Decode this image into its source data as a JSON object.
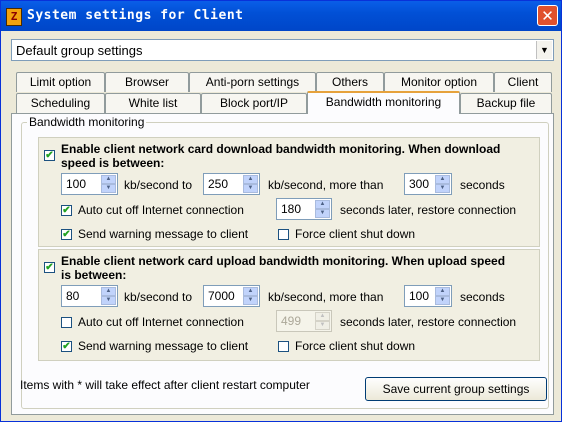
{
  "window": {
    "title": "System settings for Client",
    "app_icon_glyph": "Z",
    "close_glyph": "✕"
  },
  "group_select": {
    "value": "Default group settings",
    "arrow": "▼"
  },
  "tabs_row1": [
    "Limit option",
    "Browser",
    "Anti-porn settings",
    "Others",
    "Monitor option",
    "Client"
  ],
  "tabs_row2": [
    "Scheduling",
    "White list",
    "Block port/IP",
    "Bandwidth monitoring",
    "Backup file"
  ],
  "active_tab": "Bandwidth monitoring",
  "groupbox_title": "Bandwidth monitoring",
  "download": {
    "enabled": true,
    "label_line1": "Enable client network card download bandwidth monitoring. When download",
    "label_line2": "speed is between:",
    "min": "100",
    "unit1": "kb/second to",
    "max": "250",
    "unit2": "kb/second, more than",
    "duration": "300",
    "unit3": "seconds",
    "auto_cut": {
      "checked": true,
      "label": "Auto cut off Internet connection"
    },
    "restore_after": "180",
    "restore_label": "seconds later, restore connection",
    "send_warning": {
      "checked": true,
      "label": "Send warning message to client"
    },
    "force_shutdown": {
      "checked": false,
      "label": "Force client shut down"
    }
  },
  "upload": {
    "enabled": true,
    "label_line1": "Enable client network card upload bandwidth monitoring. When upload speed",
    "label_line2": "is between:",
    "min": "80",
    "unit1": "kb/second to",
    "max": "7000",
    "unit2": "kb/second, more than",
    "duration": "100",
    "unit3": "seconds",
    "auto_cut": {
      "checked": false,
      "label": "Auto cut off Internet connection"
    },
    "restore_after": "499",
    "restore_label": "seconds later, restore connection",
    "send_warning": {
      "checked": true,
      "label": "Send warning message to client"
    },
    "force_shutdown": {
      "checked": false,
      "label": "Force client shut down"
    }
  },
  "footer_note": "Items with * will take effect after client restart computer",
  "save_button": "Save current group settings",
  "check_glyph": "✔",
  "spin_up": "▲",
  "spin_down": "▼"
}
